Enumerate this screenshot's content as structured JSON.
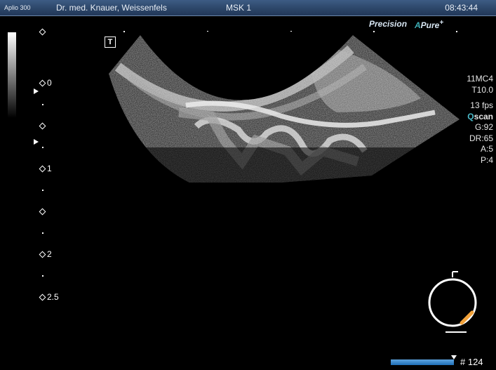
{
  "header": {
    "model": "Aplio 300",
    "institution": "Dr. med. Knauer, Weissenfels",
    "preset": "MSK 1",
    "time": "08:43:44"
  },
  "brand": {
    "precision": "Precision",
    "apure_a": "A",
    "apure_text": "Pure",
    "apure_plus": "+"
  },
  "params": {
    "probe": "11MC4",
    "freq": "T10.0",
    "fps": "13 fps",
    "qscan_q": "Q",
    "qscan_s": "scan",
    "gain": "G:92",
    "dr": "DR:65",
    "a": "A:5",
    "p": "P:4"
  },
  "depth_labels": [
    "0",
    "1",
    "2",
    "2.5"
  ],
  "t_marker": "T",
  "frame": "# 124",
  "colors": {
    "header": "#2b4466",
    "accent": "#3fb0b8",
    "probe_marker": "#f2a23a"
  }
}
